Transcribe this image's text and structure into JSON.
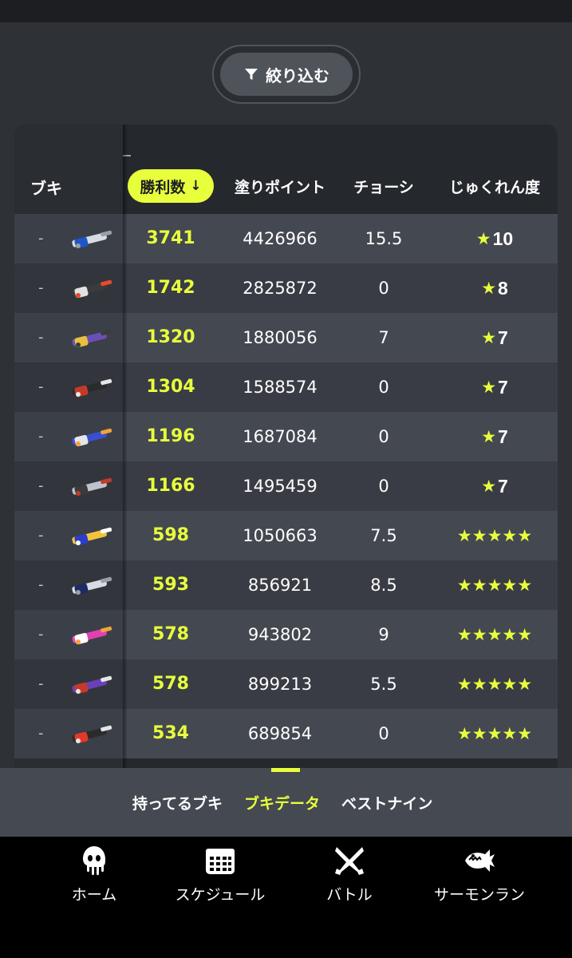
{
  "filter": {
    "label": "絞り込む",
    "icon": "filter-icon"
  },
  "table": {
    "headers": {
      "buki": "ブキ",
      "wins": "勝利数",
      "wins_sort_arrow": "↓",
      "turf_points": "塗りポイント",
      "choshi": "チョーシ",
      "mastery": "じゅくれん度"
    },
    "rows": [
      {
        "rank": "-",
        "weapon_icon": "weapon-icon-splattershot-jr",
        "wins": "3741",
        "turf_points": "4426966",
        "choshi": "15.5",
        "mastery_star": "★",
        "mastery_level": "10",
        "stars": ""
      },
      {
        "rank": "-",
        "weapon_icon": "weapon-icon-blaster",
        "wins": "1742",
        "turf_points": "2825872",
        "choshi": "0",
        "mastery_star": "★",
        "mastery_level": "8",
        "stars": ""
      },
      {
        "rank": "-",
        "weapon_icon": "weapon-icon-charger",
        "wins": "1320",
        "turf_points": "1880056",
        "choshi": "7",
        "mastery_star": "★",
        "mastery_level": "7",
        "stars": ""
      },
      {
        "rank": "-",
        "weapon_icon": "weapon-icon-roller",
        "wins": "1304",
        "turf_points": "1588574",
        "choshi": "0",
        "mastery_star": "★",
        "mastery_level": "7",
        "stars": ""
      },
      {
        "rank": "-",
        "weapon_icon": "weapon-icon-dualies",
        "wins": "1196",
        "turf_points": "1687084",
        "choshi": "0",
        "mastery_star": "★",
        "mastery_level": "7",
        "stars": ""
      },
      {
        "rank": "-",
        "weapon_icon": "weapon-icon-shooter",
        "wins": "1166",
        "turf_points": "1495459",
        "choshi": "0",
        "mastery_star": "★",
        "mastery_level": "7",
        "stars": ""
      },
      {
        "rank": "-",
        "weapon_icon": "weapon-icon-splatterscope",
        "wins": "598",
        "turf_points": "1050663",
        "choshi": "7.5",
        "mastery_star": "",
        "mastery_level": "",
        "stars": "★★★★★"
      },
      {
        "rank": "-",
        "weapon_icon": "weapon-icon-squeezer",
        "wins": "593",
        "turf_points": "856921",
        "choshi": "8.5",
        "mastery_star": "",
        "mastery_level": "",
        "stars": "★★★★★"
      },
      {
        "rank": "-",
        "weapon_icon": "weapon-icon-splattershot",
        "wins": "578",
        "turf_points": "943802",
        "choshi": "9",
        "mastery_star": "",
        "mastery_level": "",
        "stars": "★★★★★"
      },
      {
        "rank": "-",
        "weapon_icon": "weapon-icon-eliter",
        "wins": "578",
        "turf_points": "899213",
        "choshi": "5.5",
        "mastery_star": "",
        "mastery_level": "",
        "stars": "★★★★★"
      },
      {
        "rank": "-",
        "weapon_icon": "weapon-icon-brush",
        "wins": "534",
        "turf_points": "689854",
        "choshi": "0",
        "mastery_star": "",
        "mastery_level": "",
        "stars": "★★★★★"
      }
    ]
  },
  "segments": {
    "items": [
      "持ってるブキ",
      "ブキデータ",
      "ベストナイン"
    ],
    "active": "ブキデータ"
  },
  "nav": {
    "items": [
      {
        "label": "ホーム",
        "icon": "squid-icon"
      },
      {
        "label": "スケジュール",
        "icon": "calendar-icon"
      },
      {
        "label": "バトル",
        "icon": "battle-icon"
      },
      {
        "label": "サーモンラン",
        "icon": "salmon-icon"
      }
    ]
  },
  "colors": {
    "accent": "#e8ff3c",
    "background": "#2e3136",
    "row_odd": "#444851",
    "row_even": "#393c44",
    "nav_bg": "#000000"
  }
}
